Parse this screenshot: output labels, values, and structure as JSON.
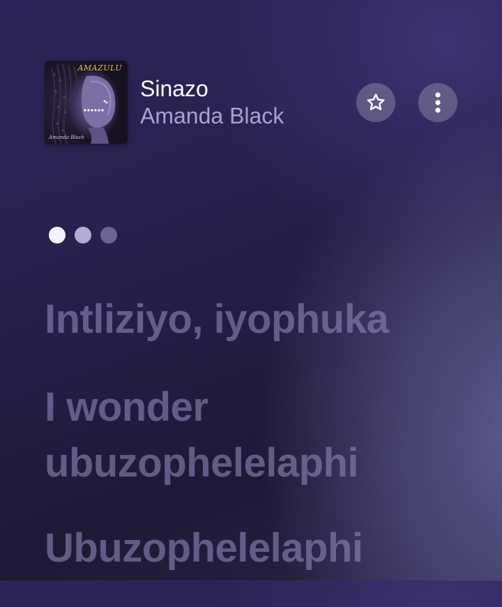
{
  "track": {
    "title": "Sinazo",
    "artist": "Amanda Black"
  },
  "album_art": {
    "brand_text": "AMAZULU",
    "signature_text": "Amanda Black"
  },
  "actions": {
    "favorite_icon": "star-outline-icon",
    "more_icon": "more-vertical-icon"
  },
  "pager": {
    "count": 3,
    "active_index": 0
  },
  "lyrics": [
    "Intliziyo, iyophuka",
    "I wonder ubuzophelelaphi",
    "Ubuzophelelaphi"
  ],
  "colors": {
    "title": "#ffffff",
    "artist": "#a9a2cf",
    "lyrics": "#8c84b4"
  }
}
